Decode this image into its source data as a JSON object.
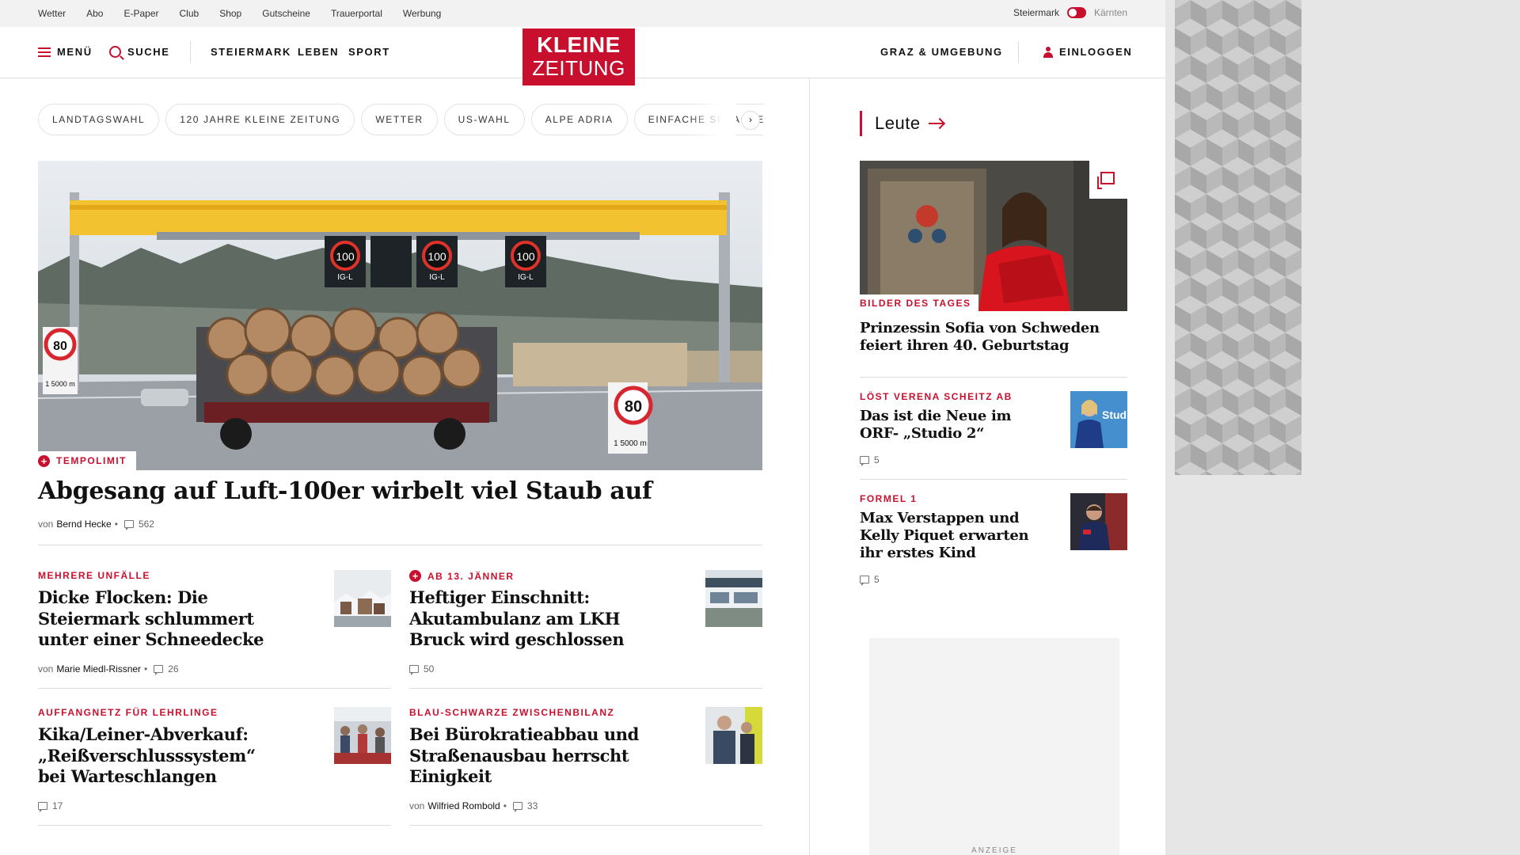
{
  "utility_bar": {
    "links": [
      "Wetter",
      "Abo",
      "E-Paper",
      "Club",
      "Shop",
      "Gutscheine",
      "Trauerportal",
      "Werbung"
    ],
    "region_active": "Steiermark",
    "region_inactive": "Kärnten"
  },
  "header": {
    "menu_label": "MENÜ",
    "search_label": "SUCHE",
    "nav": [
      "STEIERMARK",
      "LEBEN",
      "SPORT"
    ],
    "logo_line1": "KLEINE",
    "logo_line2": "ZEITUNG",
    "local_label": "GRAZ & UMGEBUNG",
    "login_label": "EINLOGGEN"
  },
  "topics": [
    "LANDTAGSWAHL",
    "120 JAHRE KLEINE ZEITUNG",
    "WETTER",
    "US-WAHL",
    "ALPE ADRIA",
    "EINFACHE SPRACHE"
  ],
  "topics_next": "›",
  "hero": {
    "kicker": "TEMPOLIMIT",
    "title": "Abgesang auf Luft-100er wirbelt viel Staub auf",
    "by": "von",
    "author": "Bernd Hecke",
    "separator": "•",
    "comments": "562",
    "sign_100": "100",
    "sign_sub": "IG-L",
    "sign_80": "80",
    "sign_dist": "1 5000 m"
  },
  "articles": [
    {
      "kicker": "MEHRERE UNFÄLLE",
      "title": "Dicke Flocken: Die Steiermark schlummert unter einer Schneedecke",
      "by": "von",
      "author": "Marie Miedl-Rissner",
      "separator": "•",
      "comments": "26",
      "plus": false
    },
    {
      "kicker": "AB 13. JÄNNER",
      "title": "Heftiger Einschnitt: Akutambulanz am LKH Bruck wird geschlossen",
      "by": "",
      "author": "",
      "separator": "",
      "comments": "50",
      "plus": true
    },
    {
      "kicker": "AUFFANGNETZ FÜR LEHRLINGE",
      "title": "Kika/Leiner-Abverkauf: „Reißverschlusssystem“ bei Warteschlangen",
      "by": "",
      "author": "",
      "separator": "",
      "comments": "17",
      "plus": false
    },
    {
      "kicker": "BLAU-SCHWARZE ZWISCHENBILANZ",
      "title": "Bei Bürokratieabbau und Straßenausbau herrscht Einigkeit",
      "by": "von",
      "author": "Wilfried Rombold",
      "separator": "•",
      "comments": "33",
      "plus": false
    }
  ],
  "sidebar": {
    "section_title": "Leute",
    "main": {
      "kicker": "BILDER DES TAGES",
      "title": "Prinzessin Sofia von Schweden feiert ihren 40. Geburtstag"
    },
    "items": [
      {
        "kicker": "LÖST VERENA SCHEITZ AB",
        "title": "Das ist die Neue im ORF- „Studio 2“",
        "comments": "5",
        "thumb_text": "Studio"
      },
      {
        "kicker": "FORMEL 1",
        "title": "Max Verstappen und Kelly Piquet erwarten ihr erstes Kind",
        "comments": "5"
      }
    ],
    "ad_label": "ANZEIGE"
  },
  "colors": {
    "brand_red": "#c8102e"
  }
}
